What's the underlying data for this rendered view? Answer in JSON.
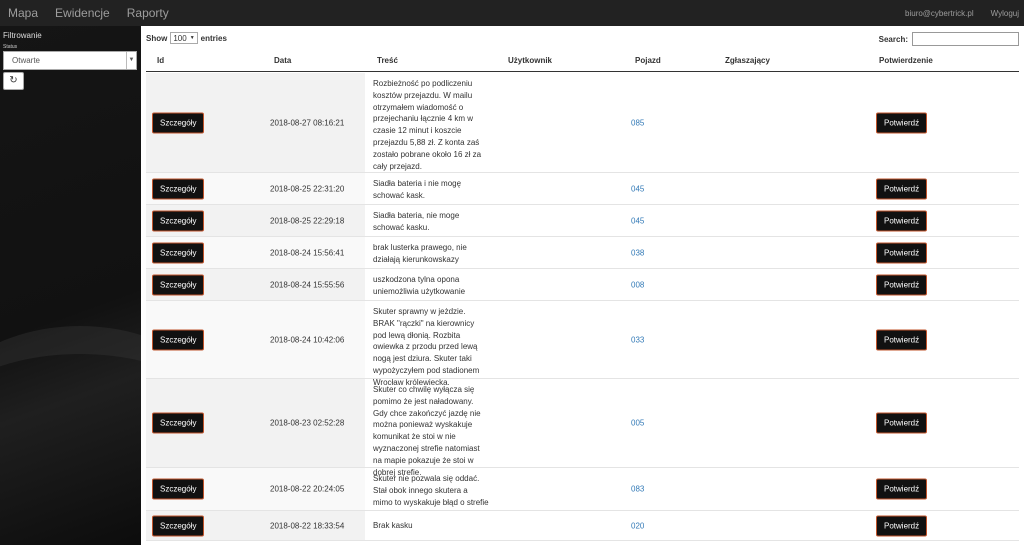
{
  "nav": {
    "items": [
      "Mapa",
      "Ewidencje",
      "Raporty"
    ],
    "user_email": "biuro@cybertrick.pl",
    "logout_label": "Wyloguj"
  },
  "sidebar": {
    "title": "Filtrowanie",
    "status_label": "Status",
    "status_value": "Otwarte",
    "refresh_icon": "refresh-icon"
  },
  "table": {
    "show_label": "Show",
    "page_length": "100",
    "entries_label": "entries",
    "search_label": "Search:",
    "search_value": "",
    "columns": [
      "Id",
      "Data",
      "Treść",
      "Użytkownik",
      "Pojazd",
      "Zgłaszający",
      "Potwierdzenie"
    ],
    "details_label": "Szczegóły",
    "confirm_label": "Potwierdź",
    "rows": [
      {
        "date": "2018-08-27 08:16:21",
        "text": "Rozbieżność po podliczeniu kosztów przejazdu. W mailu otrzymałem wiadomość o przejechaniu łącznie 4 km w czasie 12 minut i koszcie przejazdu 5,88 zł. Z konta zaś zostało pobrane około 16 zł za cały przejazd.",
        "vehicle": "085"
      },
      {
        "date": "2018-08-25 22:31:20",
        "text": "Siadła bateria i nie mogę schować kask.",
        "vehicle": "045"
      },
      {
        "date": "2018-08-25 22:29:18",
        "text": "Siadła bateria, nie moge schować kasku.",
        "vehicle": "045"
      },
      {
        "date": "2018-08-24 15:56:41",
        "text": "brak lusterka prawego, nie działają kierunkowskazy",
        "vehicle": "038"
      },
      {
        "date": "2018-08-24 15:55:56",
        "text": "uszkodzona tylna opona uniemożliwia użytkowanie",
        "vehicle": "008"
      },
      {
        "date": "2018-08-24 10:42:06",
        "text": "Skuter sprawny w jeżdzie. BRAK \"rączki\" na kierownicy pod lewą dłonią. Rozbita owiewka z przodu przed lewą nogą jest dziura. Skuter taki wypożyczyłem pod stadionem Wrocław królewiecka.",
        "vehicle": "033"
      },
      {
        "date": "2018-08-23 02:52:28",
        "text": "Skuter co chwilę wyłącza się pomimo że jest naładowany. Gdy chce zakończyć jazdę nie można ponieważ wyskakuje komunikat że stoi w nie wyznaczonej strefie natomiast na mapie pokazuje że stoi w dobrej strefie.",
        "vehicle": "005"
      },
      {
        "date": "2018-08-22 20:24:05",
        "text": "Skuter nie pozwala się oddać. Stał obok innego skutera a mimo to wyskakuje błąd o strefie",
        "vehicle": "083"
      },
      {
        "date": "2018-08-22 18:33:54",
        "text": "Brak kasku",
        "vehicle": "020"
      }
    ]
  }
}
